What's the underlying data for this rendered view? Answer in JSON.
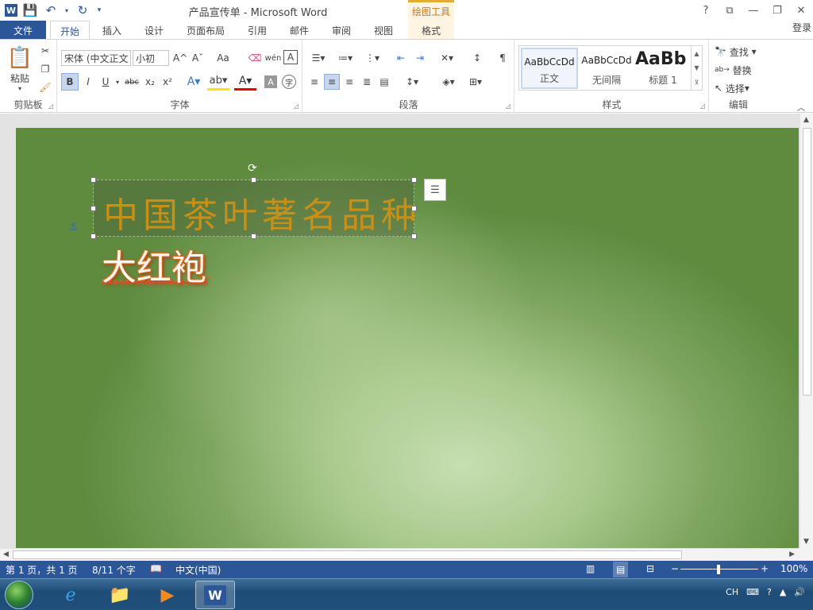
{
  "window": {
    "title": "产品宣传单 - Microsoft Word",
    "context_tab_header": "绘图工具",
    "controls": {
      "help": "?",
      "ribbon_display": "⧉",
      "minimize": "—",
      "restore": "❐",
      "close": "✕"
    }
  },
  "qat": {
    "icons": [
      "word-logo-icon",
      "save-icon",
      "undo-icon",
      "redo-icon",
      "customize-icon"
    ],
    "word_logo": "W"
  },
  "tabs": {
    "file": "文件",
    "items": [
      "开始",
      "插入",
      "设计",
      "页面布局",
      "引用",
      "邮件",
      "审阅",
      "视图"
    ],
    "context": "格式",
    "active": "开始",
    "login": "登录"
  },
  "ribbon": {
    "clipboard": {
      "label": "剪贴板",
      "paste": "粘贴"
    },
    "font": {
      "label": "字体",
      "font_name": "宋体 (中文正文",
      "font_size": "小初",
      "bold": "B",
      "italic": "I",
      "underline": "U",
      "strike": "abc",
      "sub": "x₂",
      "sup": "x²",
      "grow": "A^",
      "shrink": "Aˇ",
      "case": "Aa",
      "phonetic": "wén",
      "border": "A"
    },
    "paragraph": {
      "label": "段落"
    },
    "styles": {
      "label": "样式",
      "items": [
        {
          "preview": "AaBbCcDd",
          "name": "正文"
        },
        {
          "preview": "AaBbCcDd",
          "name": "无间隔"
        },
        {
          "preview": "AaBb",
          "name": "标题 1"
        }
      ]
    },
    "editing": {
      "label": "编辑",
      "find": "查找",
      "replace": "替换",
      "select": "选择"
    }
  },
  "document": {
    "textbox_text": "中国茶叶著名品种",
    "body_text": "大红袍",
    "paragraph_mark": "↵"
  },
  "status": {
    "page": "第 1 页，共 1 页",
    "words": "8/11 个字",
    "language": "中文(中国)",
    "zoom": "100%"
  },
  "taskbar": {
    "tray_lang": "CH"
  }
}
